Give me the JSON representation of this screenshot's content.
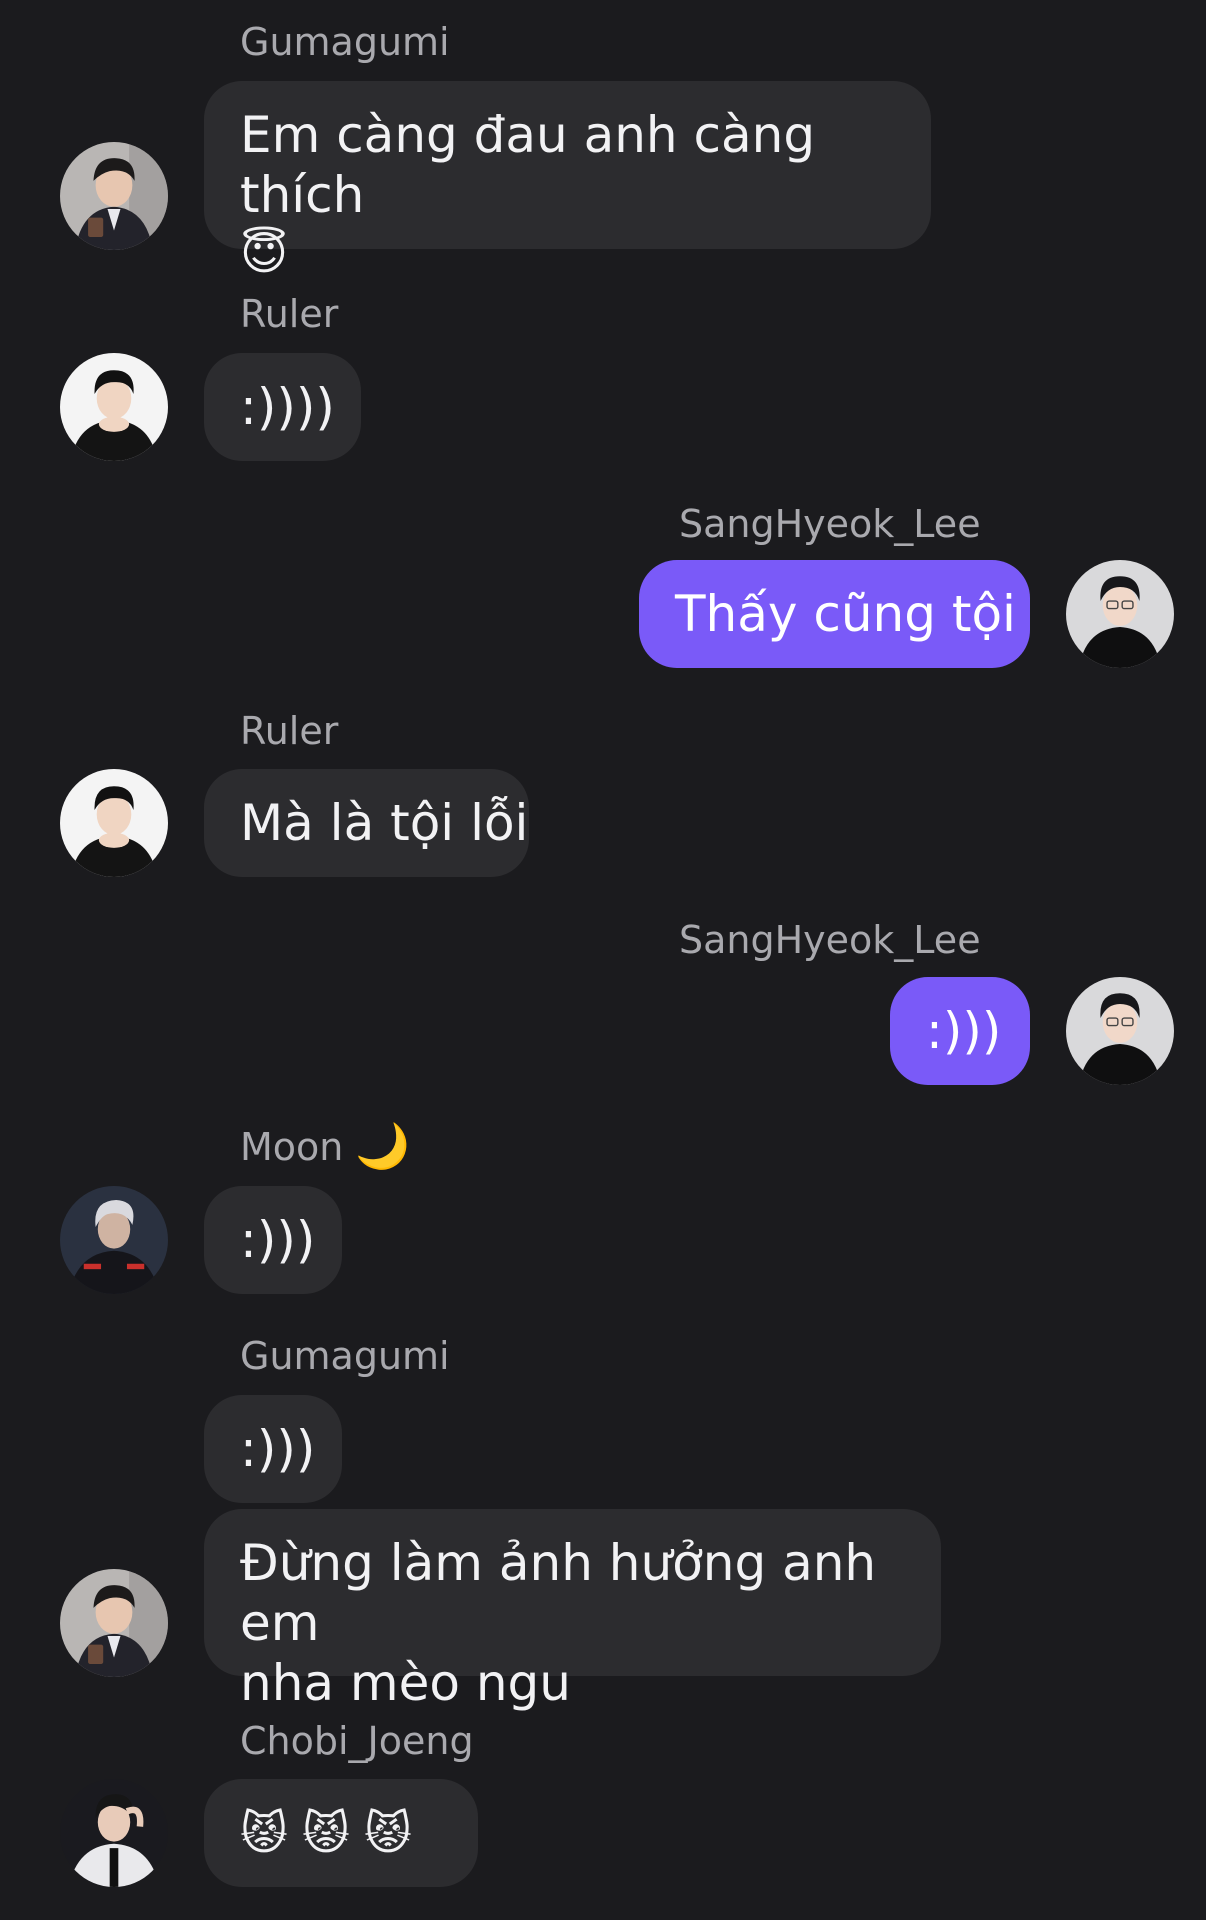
{
  "messages": [
    {
      "sender": "Gumagumi",
      "line1": "Em càng đau anh càng thích",
      "emoji": "😇"
    },
    {
      "sender": "Ruler",
      "text": ":))))"
    },
    {
      "sender": "SangHyeok_Lee",
      "text": "Thấy cũng tội"
    },
    {
      "sender": "Ruler",
      "text": "Mà là tội lỗi"
    },
    {
      "sender": "SangHyeok_Lee",
      "text": ":)))"
    },
    {
      "sender": "Moon",
      "sender_emoji": "🌙",
      "text": ":)))"
    },
    {
      "sender": "Gumagumi",
      "text": ":)))",
      "text2_line1": "Đừng làm ảnh hưởng anh em",
      "text2_line2": "nha mèo ngu"
    },
    {
      "sender": "Chobi_Joeng",
      "emojis": [
        "😾",
        "😾",
        "😾"
      ]
    }
  ],
  "avatars": {
    "gumagumi": {
      "bg": "#b9b6b4",
      "hair": "#1c1a1a",
      "skin": "#e7c6b0",
      "clothes": "#23232b"
    },
    "ruler": {
      "bg": "#f4f4f4",
      "hair": "#111111",
      "skin": "#f0d5c2",
      "clothes": "#141414"
    },
    "sanghyeok": {
      "bg": "#d9d9db",
      "hair": "#17171a",
      "skin": "#f1d8c9",
      "clothes": "#0f0f10"
    },
    "moon": {
      "bg": "#2a3140",
      "hair": "#d9d9de",
      "skin": "#cfb3a2",
      "clothes": "#15151a"
    },
    "chobi": {
      "bg": "#1a1a1f",
      "hair": "#161616",
      "skin": "#e8cbb9",
      "clothes": "#e9e9ec"
    }
  },
  "colors": {
    "background": "#1b1b1e",
    "bubble": "#2c2c2f",
    "own_bubble": "#7a5af8",
    "sender_text": "#a9a9ae"
  }
}
